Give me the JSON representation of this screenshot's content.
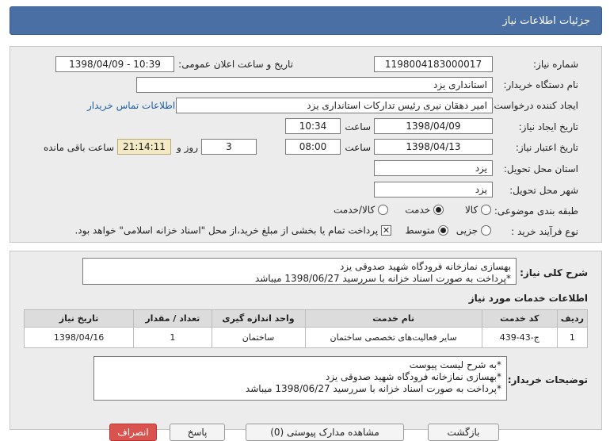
{
  "title": "جزئیات اطلاعات نیاز",
  "fields": {
    "need_number_label": "شماره نیاز:",
    "need_number": "1198004183000017",
    "announce_label": "تاریخ و ساعت اعلان عمومی:",
    "announce_value": "1398/04/09 - 10:39",
    "buyer_label": "نام دستگاه خریدار:",
    "buyer": "استانداری یزد",
    "creator_label": "ایجاد کننده درخواست:",
    "creator": "امیر دهقان نیری رئیس تدارکات استانداری یزد",
    "contact_link": "اطلاعات تماس خریدار",
    "created_label": "تاریخ ایجاد نیاز:",
    "created_date": "1398/04/09",
    "time_label": "ساعت",
    "created_time": "10:34",
    "valid_label": "تاریخ اعتبار نیاز:",
    "valid_date": "1398/04/13",
    "valid_time": "08:00",
    "days": "3",
    "days_label": "روز و",
    "remaining": "21:14:11",
    "remaining_label": "ساعت باقی مانده",
    "province_label": "استان محل تحویل:",
    "province": "یزد",
    "city_label": "شهر محل تحویل:",
    "city": "یزد",
    "category_label": "طبقه بندی موضوعی:",
    "category_options": [
      "کالا",
      "خدمت",
      "کالا/خدمت"
    ],
    "category_selected": "خدمت",
    "process_label": "نوع فرآیند خرید :",
    "process_options": [
      "جزیی",
      "متوسط"
    ],
    "process_selected": "متوسط",
    "treasury_note": "پرداخت تمام یا بخشی از مبلغ خرید،از محل \"اسناد خزانه اسلامی\" خواهد بود."
  },
  "summary": {
    "label": "شرح کلی نیاز:",
    "line1": "بهسازی نمازخانه فرودگاه شهید صدوقی یزد",
    "line2": "*پرداخت به صورت اسناد خزانه با سررسید 1398/06/27 میباشد"
  },
  "services": {
    "title": "اطلاعات خدمات مورد نیاز",
    "headers": [
      "ردیف",
      "کد خدمت",
      "نام خدمت",
      "واحد اندازه گیری",
      "تعداد / مقدار",
      "تاریخ نیاز"
    ],
    "rows": [
      [
        "1",
        "ج-43-439",
        "سایر فعالیت‌های تخصصی ساختمان",
        "ساختمان",
        "1",
        "1398/04/16"
      ]
    ]
  },
  "buyer_notes": {
    "label": "توضیحات خریدار:",
    "line1": "*به شرح لیست پیوست",
    "line2": "*بهسازی نمازخانه فرودگاه شهید صدوقی یزد",
    "line3": "*پرداخت به صورت اسناد خزانه با سررسید 1398/06/27 میباشد"
  },
  "buttons": {
    "b1": "بازگشت",
    "b2": "مشاهده مدارک پیوستی (0)",
    "b3": "پاسخ",
    "b4": "انصراف"
  },
  "colors": {
    "header": "#4a6fa5",
    "link": "#1f5fa8",
    "timer_bg": "#f3e9c4"
  }
}
